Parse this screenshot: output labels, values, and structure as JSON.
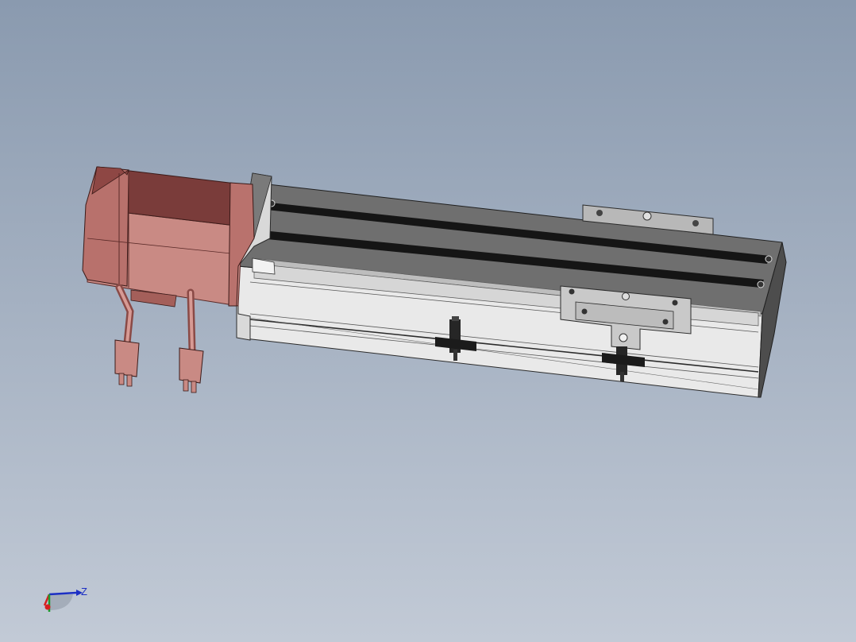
{
  "viewport": {
    "background_top": "#8a9aaf",
    "background_bottom": "#c2cad6"
  },
  "model": {
    "motor_color": "#c98a84",
    "motor_dark": "#7a3c3a",
    "rail_light": "#e6e6e6",
    "rail_dark": "#5c5c5c",
    "slot_color": "#1a1a1a"
  },
  "triad": {
    "z_label": "Z",
    "x_color": "#d62020",
    "y_color": "#1f9a2e",
    "z_color": "#1c2fc4"
  }
}
